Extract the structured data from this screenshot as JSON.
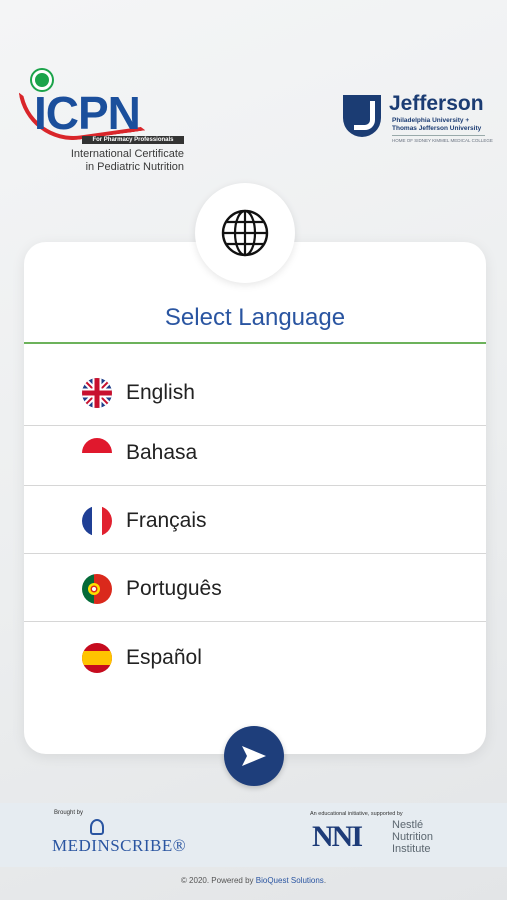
{
  "header": {
    "icpn_word": "ICPN",
    "icpn_bar": "For Pharmacy Professionals",
    "icpn_sub_line1": "International Certificate",
    "icpn_sub_line2": "in Pediatric Nutrition",
    "jefferson_name": "Jefferson",
    "jefferson_sub_line1": "Philadelphia University +",
    "jefferson_sub_line2": "Thomas Jefferson University",
    "jefferson_tag": "HOME OF SIDNEY KIMMEL MEDICAL COLLEGE"
  },
  "card": {
    "title": "Select Language",
    "languages": [
      {
        "label": "English",
        "flag": "uk-flag-icon"
      },
      {
        "label": "Bahasa",
        "flag": "indonesia-flag-icon"
      },
      {
        "label": "Français",
        "flag": "france-flag-icon"
      },
      {
        "label": "Português",
        "flag": "portugal-flag-icon"
      },
      {
        "label": "Español",
        "flag": "spain-flag-icon"
      }
    ]
  },
  "footer": {
    "brought_by": "Brought by",
    "medinscribe": "MEDINSCRIBE®",
    "educational": "An educational initiative, supported by",
    "nni_mark": "NNI",
    "nni_line1": "Nestlé",
    "nni_line2": "Nutrition",
    "nni_line3": "Institute",
    "copyright_prefix": "© 2020. Powered by ",
    "copyright_link": "BioQuest Solutions",
    "copyright_suffix": "."
  },
  "colors": {
    "primary_blue": "#2a55a1",
    "dark_navy": "#1e3e7b",
    "divider_green": "#6cb25b",
    "icpn_red": "#d9252a",
    "icpn_green": "#1ba34a"
  }
}
